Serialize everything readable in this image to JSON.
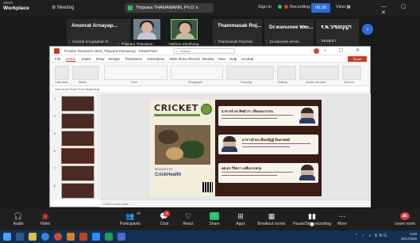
{
  "zoom": {
    "brand": {
      "top": "zoom",
      "name": "Workplace"
    },
    "meeting_label": "Meeting",
    "share_label": "Thipvara THANAWANN, Ph.D.'s",
    "signin_label": "Sign in",
    "recording_label": "Recording...",
    "time": "06:28",
    "view_label": "View",
    "window_controls": "— ▢ ✕"
  },
  "participants": [
    {
      "name": "Anunrat  Arnayap...",
      "subtitle": "Anunrat Arnayaphan R..."
    },
    {
      "name": "",
      "subtitle": "Thipvara Thanawan..."
    },
    {
      "name": "",
      "subtitle": "Nakhon wandhang..."
    },
    {
      "name": "Thammasak Roj...",
      "subtitle": "Thammasak Rojvirote"
    },
    {
      "name": "Dr.wanunee พพะ...",
      "subtitle": "Dr.wanunee wmim..."
    },
    {
      "name": "ร.พ.ว/ขอบุญฯ",
      "subtitle": "ขอบคุณฯ"
    }
  ],
  "ppt": {
    "title": "Frontier Research 2024_Thipvara Panowong - PowerPoint",
    "search": "Search",
    "tabs": [
      "File",
      "Home",
      "Insert",
      "Draw",
      "Design",
      "Transitions",
      "Animations",
      "Slide Show",
      "Record",
      "Review",
      "View",
      "Help",
      "Acrobat"
    ],
    "share": "Share",
    "ribbon_groups": [
      "Clipboard",
      "Slides",
      "Font",
      "Paragraph",
      "Drawing",
      "Editing",
      "Adobe Acrobat",
      "Add-ins"
    ],
    "qat": "New  Undo  Redo  From Beginning",
    "slide_numbers": [
      "3",
      "4",
      "5",
      "6",
      "7",
      "8"
    ],
    "notes": "Click to add notes",
    "slide": {
      "title": "CRICKET",
      "brand_small": "BRANDED BY",
      "brand": "CrickHealth",
      "people": [
        {
          "name": "อาจารย์ ดร.ทิพย์วรา เสียนธนวรรณ"
        },
        {
          "name": "อาจารย์ ดร.เสียนซัฎฐ์ บินทาพงษ์"
        },
        {
          "name": "ผศ.ดร.วิจิตรา เหลืองวรสกุล"
        }
      ]
    }
  },
  "toolbar": {
    "audio": "Audio",
    "video": "Video",
    "participants": "Participants",
    "participants_count": "10",
    "chat": "Chat",
    "chat_badge": "3",
    "react": "React",
    "share": "Share",
    "apps": "Apps",
    "breakout": "Breakout rooms",
    "pause_share": "Pause/Stop recording",
    "more": "More",
    "leave": "Leave room"
  },
  "taskbar": {
    "tray_icons": "^ ◔ ◑ ENG",
    "time": "9:48",
    "date": "20/1/2568"
  },
  "colors": {
    "zoom_bg": "#1f1f1f",
    "zoom_blue": "#2d6cdf",
    "ppt_accent": "#c43e1c",
    "slide_brown": "#3a1d15",
    "taskbar": "#132f52"
  }
}
